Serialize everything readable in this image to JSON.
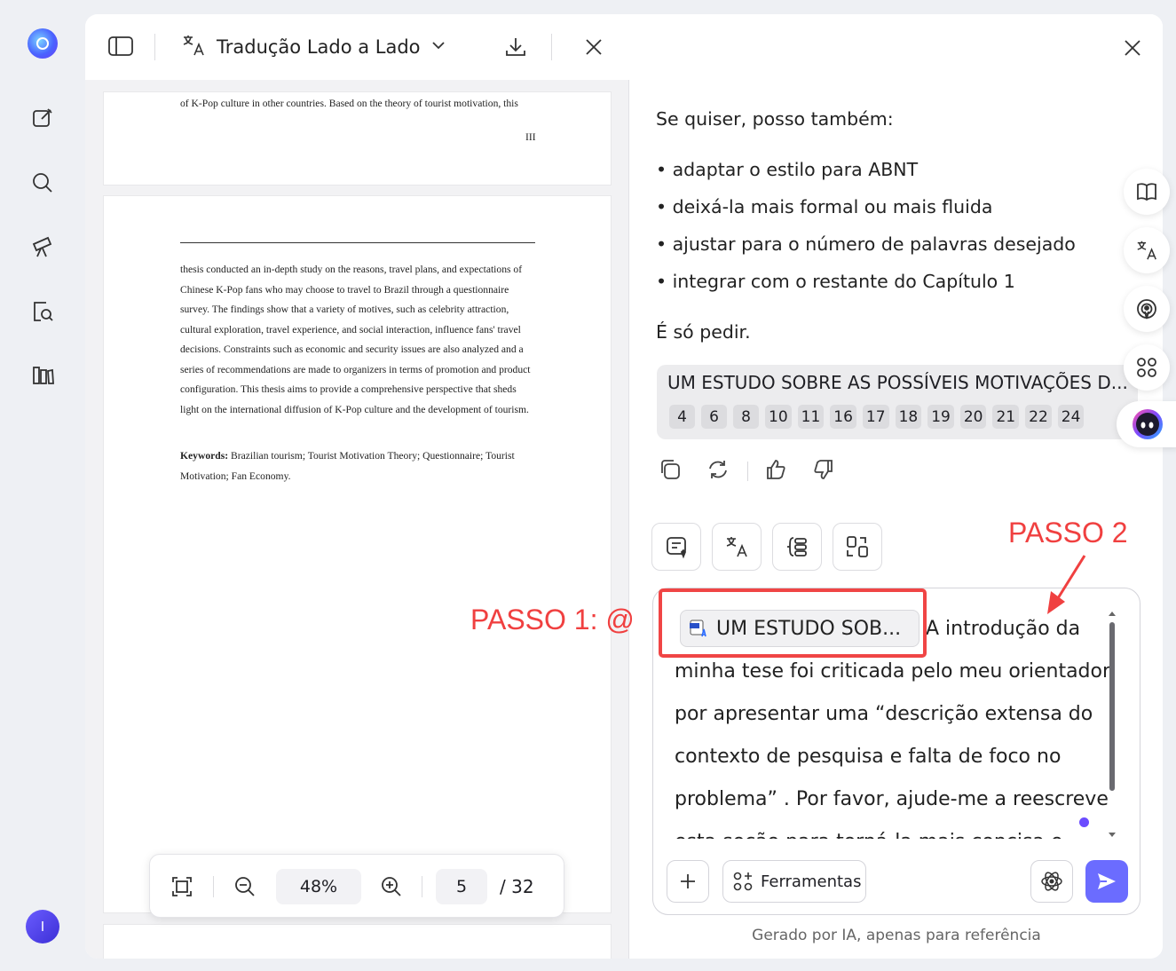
{
  "left_sidebar": {
    "icons": [
      "app-logo-icon",
      "edit-icon",
      "search-icon",
      "telescope-icon",
      "document-search-icon",
      "library-icon"
    ],
    "avatar_initial": "I"
  },
  "viewer": {
    "title": "Tradução Lado a Lado",
    "page1_line": "of K-Pop culture in other countries. Based on the theory of tourist motivation, this",
    "page1_number": "III",
    "abstract_lines": [
      "thesis conducted an in-depth study on the reasons, travel plans, and expectations of",
      "Chinese K-Pop fans who may choose to travel to Brazil through a questionnaire",
      "survey. The findings show that a variety of motives, such as celebrity attraction,",
      "cultural exploration, travel experience, and social interaction, influence fans' travel",
      "decisions. Constraints such as economic and security issues are also analyzed and a",
      "series of recommendations are made to organizers in terms of promotion and product",
      "configuration. This thesis aims to provide a comprehensive perspective that sheds",
      "light on the international diffusion of K-Pop culture and the development of tourism."
    ],
    "keywords_label": "Keywords:",
    "keywords_line1": " Brazilian tourism; Tourist Motivation Theory; Questionnaire; Tourist",
    "keywords_line2": "Motivation; Fan Economy.",
    "zoom": "48%",
    "current_page": "5",
    "total_pages": "/ 32"
  },
  "chat": {
    "intro": "Se quiser, posso também:",
    "bullets": [
      "• adaptar o estilo para ABNT",
      "• deixá-la mais formal ou mais fluida",
      "• ajustar para o número de palavras desejado",
      "• integrar com o restante do Capítulo 1"
    ],
    "closing": "É só pedir.",
    "reference_title": "UM ESTUDO SOBRE AS POSSÍVEIS MOTIVAÇÕES D...",
    "reference_pages": [
      "4",
      "6",
      "8",
      "10",
      "11",
      "16",
      "17",
      "18",
      "19",
      "20",
      "21",
      "22",
      "24"
    ]
  },
  "input": {
    "attachment_label": "UM ESTUDO SOB...",
    "lines": [
      "A introdução da",
      "minha tese foi criticada pelo meu orientador",
      "por apresentar uma  “descrição extensa do",
      "contexto de pesquisa e falta de foco no",
      "problema” . Por favor, ajude-me a reescrever",
      "esta seção para torná-la mais concisa e"
    ],
    "tools_label": "Ferramentas",
    "footnote": "Gerado por IA, apenas para referência"
  },
  "annotations": {
    "step1": "PASSO 1: @",
    "step2": "PASSO 2",
    "color": "#f04040"
  },
  "colors": {
    "accent": "#6b6cff",
    "background": "#eef0f4"
  }
}
